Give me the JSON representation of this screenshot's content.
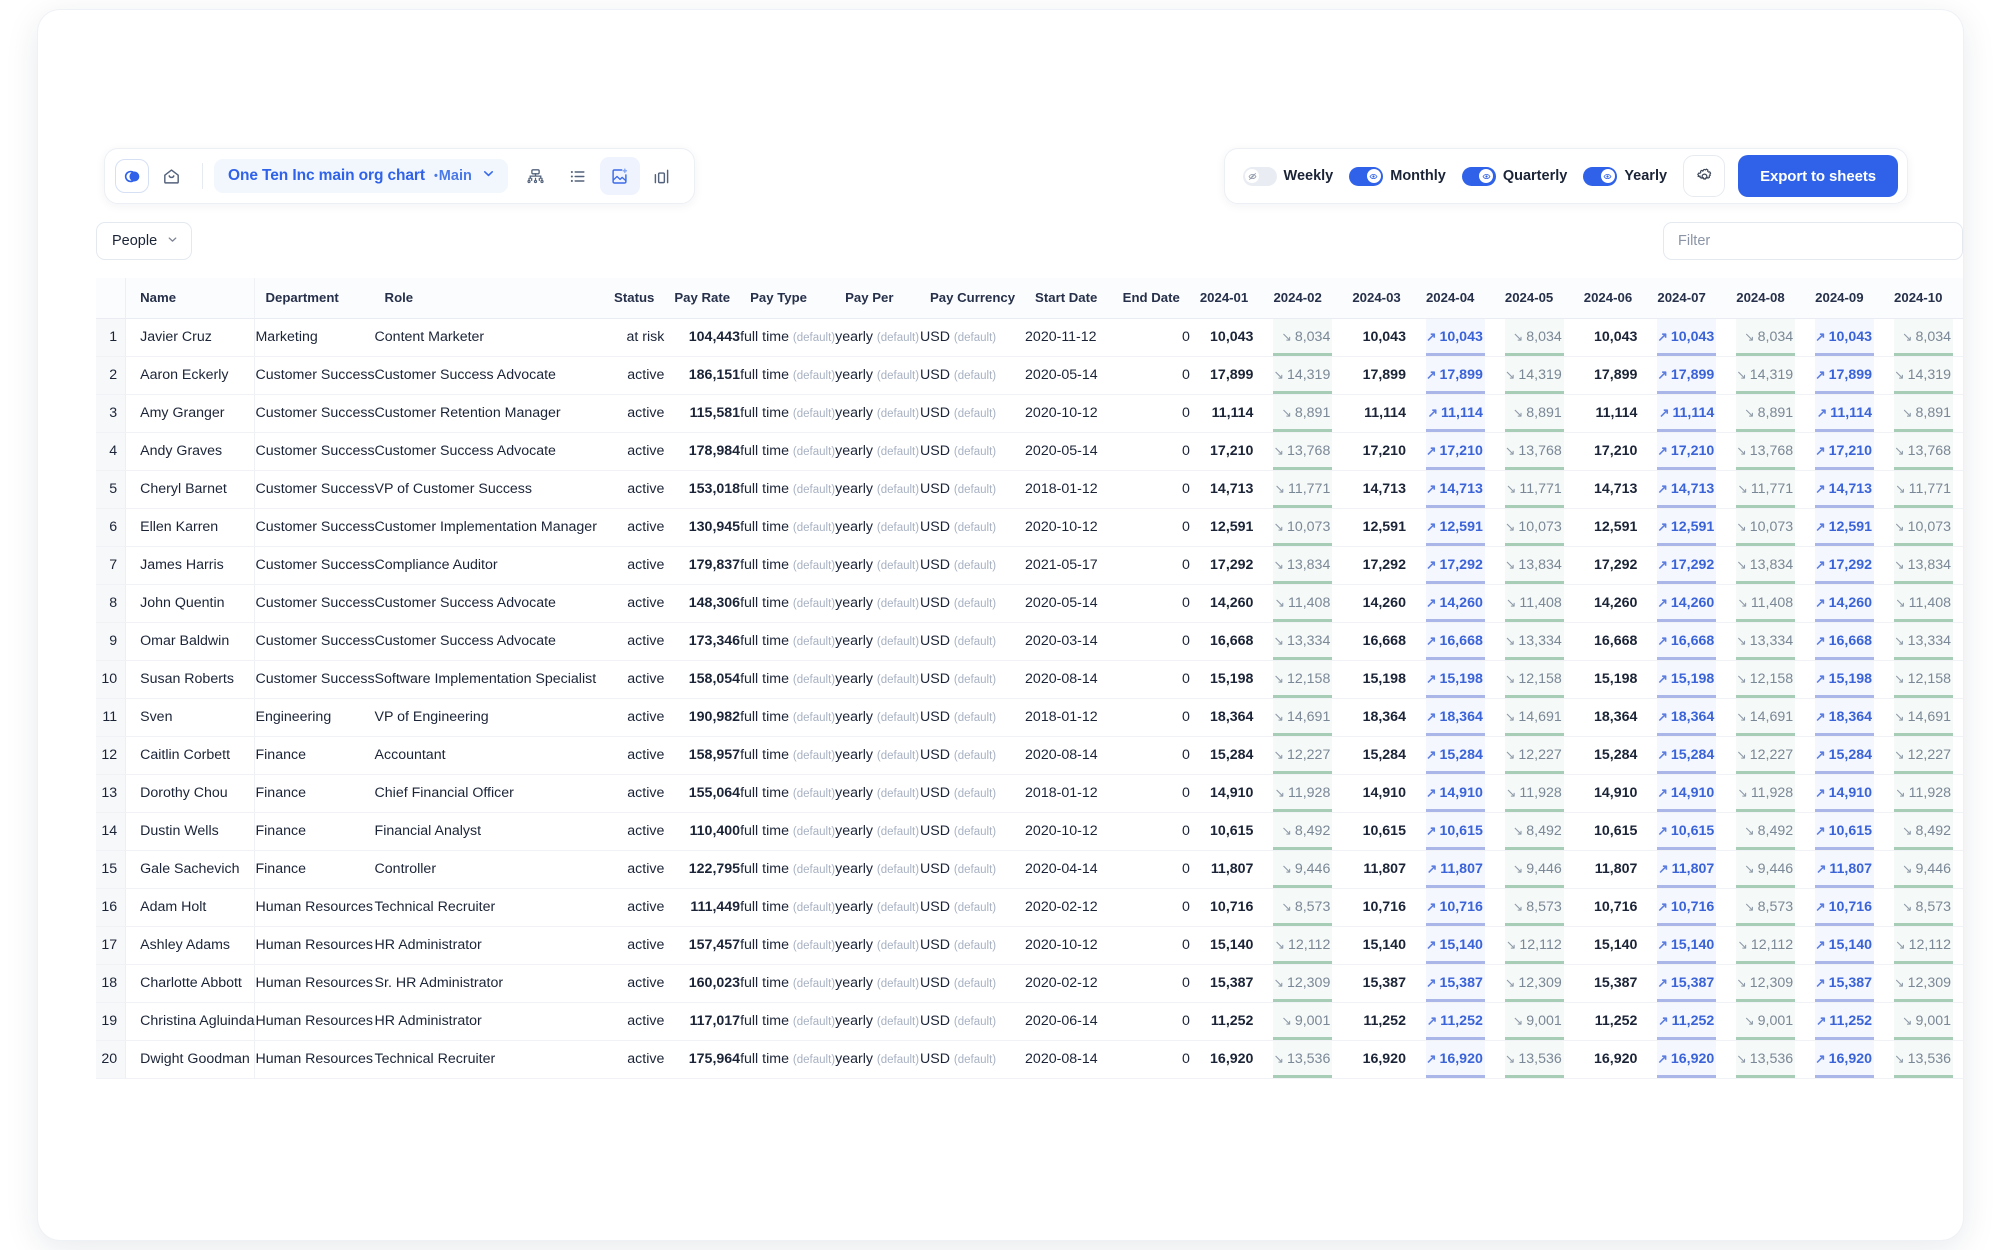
{
  "toolbar": {
    "logo_icon": "app-logo-icon",
    "home_icon": "home-icon",
    "doc_title": "One Ten Inc main org chart",
    "doc_branch_dot": "•",
    "doc_branch": "Main",
    "chevron_icon": "chevron-down-icon",
    "view_icons": [
      "org-chart-icon",
      "list-view-icon",
      "canvas-view-icon",
      "bar-chart-icon"
    ],
    "active_view": "canvas-view-icon",
    "toggles": [
      {
        "label": "Weekly",
        "on": false,
        "knob_icon": "eye-off-icon"
      },
      {
        "label": "Monthly",
        "on": true,
        "knob_icon": "eye-icon"
      },
      {
        "label": "Quarterly",
        "on": true,
        "knob_icon": "eye-icon"
      },
      {
        "label": "Yearly",
        "on": true,
        "knob_icon": "eye-icon"
      }
    ],
    "settings_icon": "gear-icon",
    "export_label": "Export to sheets",
    "accent_color": "#2f62e8"
  },
  "filters": {
    "entity_label": "People",
    "entity_chevron": "chevron-down-icon",
    "filter_placeholder": "Filter",
    "filter_value": ""
  },
  "table": {
    "columns": [
      "Name",
      "Department",
      "Role",
      "Status",
      "Pay Rate",
      "Pay Type",
      "Pay Per",
      "Pay Currency",
      "Start Date",
      "End Date",
      "2024-01",
      "2024-02",
      "2024-03",
      "2024-04",
      "2024-05",
      "2024-06",
      "2024-07",
      "2024-08",
      "2024-09",
      "2024-10"
    ],
    "month_columns": [
      "2024-01",
      "2024-02",
      "2024-03",
      "2024-04",
      "2024-05",
      "2024-06",
      "2024-07",
      "2024-08",
      "2024-09",
      "2024-10"
    ],
    "default_suffix": "(default)",
    "pay_type_value": "full time",
    "pay_per_value": "yearly",
    "pay_currency_value": "USD",
    "up_arrow": "↗",
    "down_arrow": "↘",
    "month_pattern": [
      "plain",
      "down",
      "plain",
      "up",
      "down",
      "plain",
      "up",
      "down",
      "up",
      "down"
    ],
    "rows": [
      {
        "idx": 1,
        "name": "Javier Cruz",
        "dept": "Marketing",
        "role": "Content Marketer",
        "status": "at risk",
        "pay_rate": "104,443",
        "start": "2020-11-12",
        "end": "0",
        "high": "10,043",
        "low": "8,034"
      },
      {
        "idx": 2,
        "name": "Aaron Eckerly",
        "dept": "Customer Success",
        "role": "Customer Success Advocate",
        "status": "active",
        "pay_rate": "186,151",
        "start": "2020-05-14",
        "end": "0",
        "high": "17,899",
        "low": "14,319"
      },
      {
        "idx": 3,
        "name": "Amy Granger",
        "dept": "Customer Success",
        "role": "Customer Retention Manager",
        "status": "active",
        "pay_rate": "115,581",
        "start": "2020-10-12",
        "end": "0",
        "high": "11,114",
        "low": "8,891"
      },
      {
        "idx": 4,
        "name": "Andy Graves",
        "dept": "Customer Success",
        "role": "Customer Success Advocate",
        "status": "active",
        "pay_rate": "178,984",
        "start": "2020-05-14",
        "end": "0",
        "high": "17,210",
        "low": "13,768"
      },
      {
        "idx": 5,
        "name": "Cheryl Barnet",
        "dept": "Customer Success",
        "role": "VP of Customer Success",
        "status": "active",
        "pay_rate": "153,018",
        "start": "2018-01-12",
        "end": "0",
        "high": "14,713",
        "low": "11,771"
      },
      {
        "idx": 6,
        "name": "Ellen Karren",
        "dept": "Customer Success",
        "role": "Customer Implementation Manager",
        "status": "active",
        "pay_rate": "130,945",
        "start": "2020-10-12",
        "end": "0",
        "high": "12,591",
        "low": "10,073"
      },
      {
        "idx": 7,
        "name": "James Harris",
        "dept": "Customer Success",
        "role": "Compliance Auditor",
        "status": "active",
        "pay_rate": "179,837",
        "start": "2021-05-17",
        "end": "0",
        "high": "17,292",
        "low": "13,834"
      },
      {
        "idx": 8,
        "name": "John Quentin",
        "dept": "Customer Success",
        "role": "Customer Success Advocate",
        "status": "active",
        "pay_rate": "148,306",
        "start": "2020-05-14",
        "end": "0",
        "high": "14,260",
        "low": "11,408"
      },
      {
        "idx": 9,
        "name": "Omar Baldwin",
        "dept": "Customer Success",
        "role": "Customer Success Advocate",
        "status": "active",
        "pay_rate": "173,346",
        "start": "2020-03-14",
        "end": "0",
        "high": "16,668",
        "low": "13,334"
      },
      {
        "idx": 10,
        "name": "Susan Roberts",
        "dept": "Customer Success",
        "role": "Software Implementation Specialist",
        "status": "active",
        "pay_rate": "158,054",
        "start": "2020-08-14",
        "end": "0",
        "high": "15,198",
        "low": "12,158"
      },
      {
        "idx": 11,
        "name": "Sven",
        "dept": "Engineering",
        "role": "VP of Engineering",
        "status": "active",
        "pay_rate": "190,982",
        "start": "2018-01-12",
        "end": "0",
        "high": "18,364",
        "low": "14,691"
      },
      {
        "idx": 12,
        "name": "Caitlin Corbett",
        "dept": "Finance",
        "role": "Accountant",
        "status": "active",
        "pay_rate": "158,957",
        "start": "2020-08-14",
        "end": "0",
        "high": "15,284",
        "low": "12,227"
      },
      {
        "idx": 13,
        "name": "Dorothy Chou",
        "dept": "Finance",
        "role": "Chief Financial Officer",
        "status": "active",
        "pay_rate": "155,064",
        "start": "2018-01-12",
        "end": "0",
        "high": "14,910",
        "low": "11,928"
      },
      {
        "idx": 14,
        "name": "Dustin Wells",
        "dept": "Finance",
        "role": "Financial Analyst",
        "status": "active",
        "pay_rate": "110,400",
        "start": "2020-10-12",
        "end": "0",
        "high": "10,615",
        "low": "8,492"
      },
      {
        "idx": 15,
        "name": "Gale Sachevich",
        "dept": "Finance",
        "role": "Controller",
        "status": "active",
        "pay_rate": "122,795",
        "start": "2020-04-14",
        "end": "0",
        "high": "11,807",
        "low": "9,446"
      },
      {
        "idx": 16,
        "name": "Adam Holt",
        "dept": "Human Resources",
        "role": "Technical Recruiter",
        "status": "active",
        "pay_rate": "111,449",
        "start": "2020-02-12",
        "end": "0",
        "high": "10,716",
        "low": "8,573"
      },
      {
        "idx": 17,
        "name": "Ashley Adams",
        "dept": "Human Resources",
        "role": "HR Administrator",
        "status": "active",
        "pay_rate": "157,457",
        "start": "2020-10-12",
        "end": "0",
        "high": "15,140",
        "low": "12,112"
      },
      {
        "idx": 18,
        "name": "Charlotte Abbott",
        "dept": "Human Resources",
        "role": "Sr. HR Administrator",
        "status": "active",
        "pay_rate": "160,023",
        "start": "2020-02-12",
        "end": "0",
        "high": "15,387",
        "low": "12,309"
      },
      {
        "idx": 19,
        "name": "Christina Agluinda",
        "dept": "Human Resources",
        "role": "HR Administrator",
        "status": "active",
        "pay_rate": "117,017",
        "start": "2020-06-14",
        "end": "0",
        "high": "11,252",
        "low": "9,001"
      },
      {
        "idx": 20,
        "name": "Dwight Goodman",
        "dept": "Human Resources",
        "role": "Technical Recruiter",
        "status": "active",
        "pay_rate": "175,964",
        "start": "2020-08-14",
        "end": "0",
        "high": "16,920",
        "low": "13,536"
      }
    ]
  }
}
